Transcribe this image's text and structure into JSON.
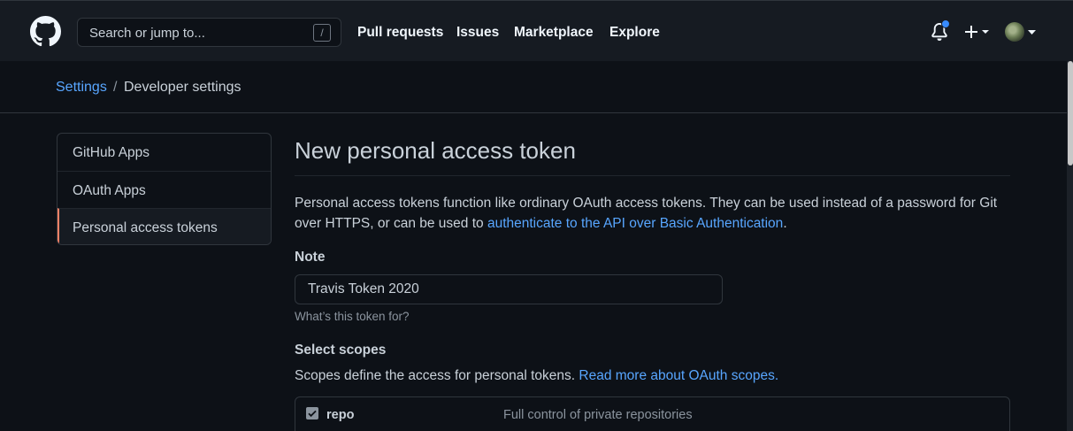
{
  "header": {
    "search_placeholder": "Search or jump to...",
    "search_shortcut": "/",
    "nav": [
      "Pull requests",
      "Issues",
      "Marketplace",
      "Explore"
    ],
    "notification_dot_color": "#388bfd"
  },
  "breadcrumb": {
    "root": "Settings",
    "separator": "/",
    "current": "Developer settings"
  },
  "sidebar": {
    "items": [
      {
        "label": "GitHub Apps"
      },
      {
        "label": "OAuth Apps"
      },
      {
        "label": "Personal access tokens",
        "selected": true
      }
    ]
  },
  "main": {
    "title": "New personal access token",
    "description_text": "Personal access tokens function like ordinary OAuth access tokens. They can be used instead of a password for Git over HTTPS, or can be used to ",
    "description_link": "authenticate to the API over Basic Authentication",
    "description_end": ".",
    "note_label": "Note",
    "note_value": "Travis Token 2020",
    "note_hint": "What’s this token for?",
    "scopes_label": "Select scopes",
    "scopes_text": "Scopes define the access for personal tokens. ",
    "scopes_link": "Read more about OAuth scopes.",
    "scopes": [
      {
        "name": "repo",
        "description": "Full control of private repositories",
        "checked": true
      }
    ]
  }
}
